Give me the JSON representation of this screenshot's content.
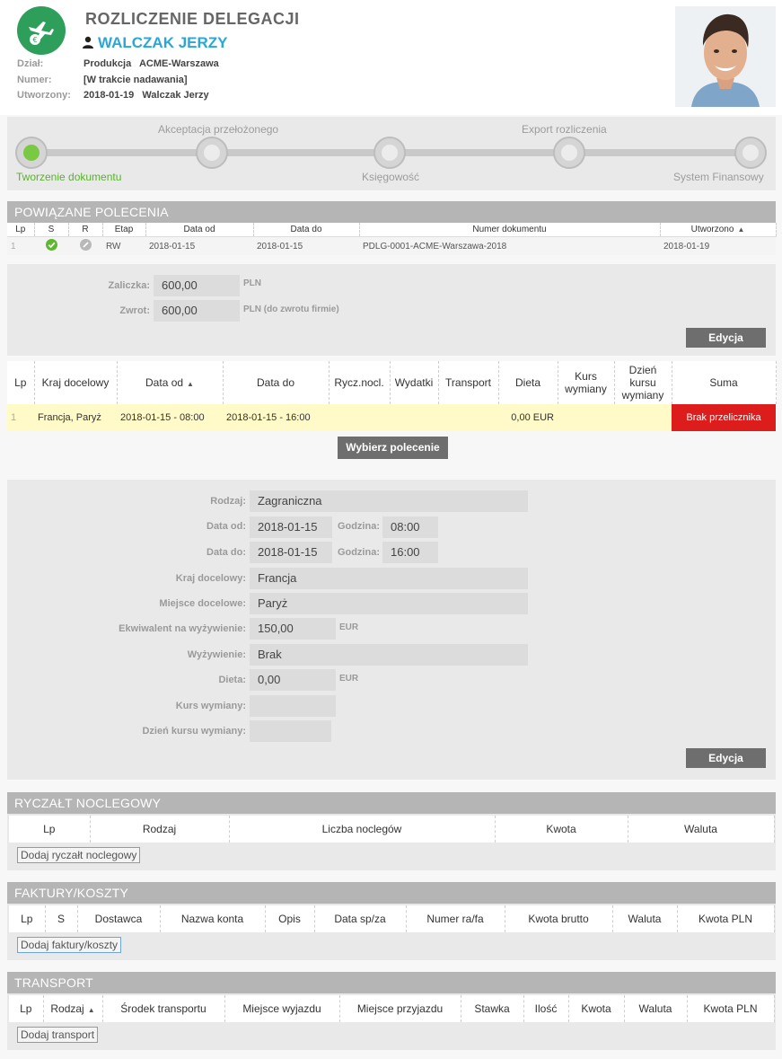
{
  "header": {
    "title": "ROZLICZENIE DELEGACJI",
    "person": "WALCZAK JERZY",
    "meta": [
      {
        "label": "Dział:",
        "value": "Produkcja   ACME-Warszawa"
      },
      {
        "label": "Numer:",
        "value": "[W trakcie nadawania]"
      },
      {
        "label": "Utworzony:",
        "value": "2018-01-19   Walczak Jerzy"
      }
    ]
  },
  "progress": {
    "steps": [
      {
        "label": "Tworzenie dokumentu",
        "active": true
      },
      {
        "label": "Akceptacja przełożonego",
        "active": false
      },
      {
        "label": "Księgowość",
        "active": false
      },
      {
        "label": "Export rozliczenia",
        "active": false
      },
      {
        "label": "System Finansowy",
        "active": false
      }
    ]
  },
  "powiazane": {
    "title": "POWIĄZANE POLECENIA",
    "columns": [
      "Lp",
      "S",
      "R",
      "Etap",
      "Data od",
      "Data do",
      "Numer dokumentu",
      "Utworzono"
    ],
    "row": {
      "lp": "1",
      "etap": "RW",
      "data_od": "2018-01-15",
      "data_do": "2018-01-15",
      "numer": "PDLG-0001-ACME-Warszawa-2018",
      "utworzono": "2018-01-19"
    }
  },
  "zaliczka": {
    "zaliczka_label": "Zaliczka:",
    "zaliczka_value": "600,00",
    "zaliczka_unit": "PLN",
    "zwrot_label": "Zwrot:",
    "zwrot_value": "600,00",
    "zwrot_unit": "PLN (do zwrotu firmie)",
    "edit_label": "Edycja"
  },
  "delegacje": {
    "columns": [
      "Lp",
      "Kraj docelowy",
      "Data od",
      "Data do",
      "Rycz.nocl.",
      "Wydatki",
      "Transport",
      "Dieta",
      "Kurs wymiany",
      "Dzień kursu wymiany",
      "Suma"
    ],
    "row": {
      "lp": "1",
      "kraj": "Francja, Paryż",
      "data_od": "2018-01-15 - 08:00",
      "data_do": "2018-01-15 - 16:00",
      "dieta": "0,00 EUR",
      "suma": "Brak przelicznika"
    },
    "select_button": "Wybierz polecenie"
  },
  "form": {
    "rodzaj_label": "Rodzaj:",
    "rodzaj": "Zagraniczna",
    "data_od_label": "Data od:",
    "data_od": "2018-01-15",
    "godz_od_label": "Godzina:",
    "godz_od": "08:00",
    "data_do_label": "Data do:",
    "data_do": "2018-01-15",
    "godz_do_label": "Godzina:",
    "godz_do": "16:00",
    "kraj_label": "Kraj docelowy:",
    "kraj": "Francja",
    "miejsce_label": "Miejsce docelowe:",
    "miejsce": "Paryż",
    "ekw_label": "Ekwiwalent na wyżywienie:",
    "ekw": "150,00",
    "ekw_unit": "EUR",
    "wyz_label": "Wyżywienie:",
    "wyz": "Brak",
    "dieta_label": "Dieta:",
    "dieta": "0,00",
    "dieta_unit": "EUR",
    "kurs_label": "Kurs wymiany:",
    "kurs": "",
    "dzien_label": "Dzień kursu wymiany:",
    "dzien": "",
    "edit_label": "Edycja"
  },
  "ryczalt": {
    "title": "RYCZAŁT NOCLEGOWY",
    "columns": [
      "Lp",
      "Rodzaj",
      "Liczba noclegów",
      "Kwota",
      "Waluta"
    ],
    "add_label": "Dodaj ryczałt noclegowy"
  },
  "faktury": {
    "title": "FAKTURY/KOSZTY",
    "columns": [
      "Lp",
      "S",
      "Dostawca",
      "Nazwa konta",
      "Opis",
      "Data sp/za",
      "Numer ra/fa",
      "Kwota brutto",
      "Waluta",
      "Kwota PLN"
    ],
    "add_label": "Dodaj faktury/koszty"
  },
  "transport": {
    "title": "TRANSPORT",
    "columns": [
      "Lp",
      "Rodzaj",
      "Środek transportu",
      "Miejsce wyjazdu",
      "Miejsce przyjazdu",
      "Stawka",
      "Ilość",
      "Kwota",
      "Waluta",
      "Kwota PLN"
    ],
    "add_label": "Dodaj transport"
  },
  "colors": {
    "accent": "#2aa7d6",
    "logo": "#2e9e5b",
    "active_step": "#7ac943",
    "error": "#dd1c1c",
    "row_highlight": "#fffac8"
  }
}
